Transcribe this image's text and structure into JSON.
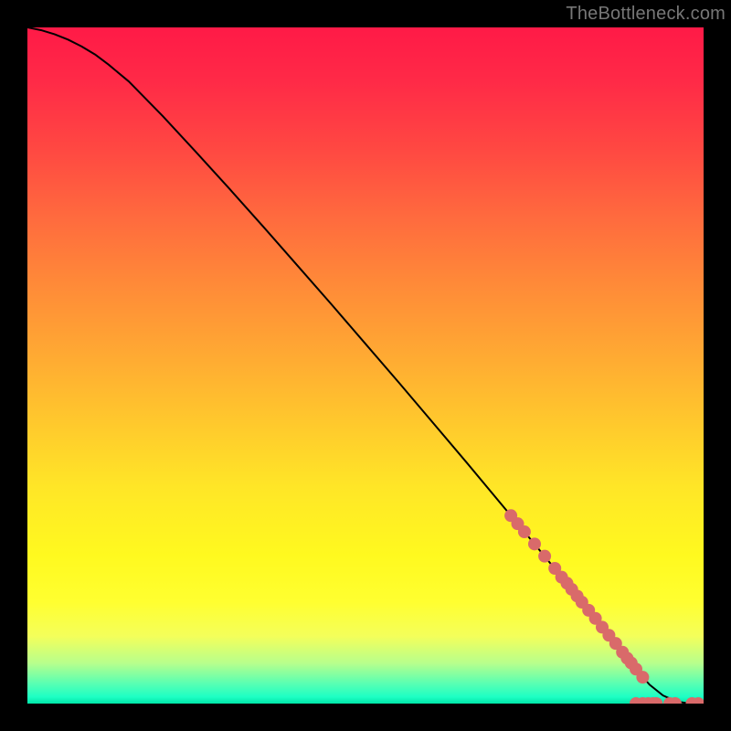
{
  "watermark": "TheBottleneck.com",
  "colors": {
    "curve": "#000000",
    "marker_fill": "#d96a6a",
    "marker_stroke": "#b85454",
    "bg_top": "#ff1a47",
    "bg_bottom": "#00e6a8",
    "page_bg": "#000000"
  },
  "chart_data": {
    "type": "line",
    "title": "",
    "xlabel": "",
    "ylabel": "",
    "xlim": [
      0,
      100
    ],
    "ylim": [
      0,
      100
    ],
    "grid": false,
    "legend": false,
    "series": [
      {
        "name": "curve",
        "x": [
          0,
          2,
          4,
          6,
          8,
          10,
          12,
          15,
          20,
          25,
          30,
          35,
          40,
          45,
          50,
          55,
          60,
          65,
          70,
          75,
          80,
          83,
          85,
          88,
          90,
          92,
          94,
          96,
          98,
          100
        ],
        "y": [
          100,
          99.6,
          99.0,
          98.2,
          97.2,
          96.0,
          94.5,
          92.0,
          86.9,
          81.5,
          76.0,
          70.4,
          64.7,
          59.0,
          53.2,
          47.4,
          41.5,
          35.6,
          29.6,
          23.6,
          17.5,
          13.8,
          11.3,
          7.6,
          5.1,
          2.8,
          1.2,
          0.3,
          0.0,
          0.0
        ]
      }
    ],
    "markers": [
      {
        "x": 71.5,
        "y": 27.8
      },
      {
        "x": 72.5,
        "y": 26.6
      },
      {
        "x": 73.5,
        "y": 25.4
      },
      {
        "x": 75.0,
        "y": 23.6
      },
      {
        "x": 76.5,
        "y": 21.8
      },
      {
        "x": 78.0,
        "y": 20.0
      },
      {
        "x": 79.0,
        "y": 18.7
      },
      {
        "x": 79.8,
        "y": 17.8
      },
      {
        "x": 80.5,
        "y": 16.9
      },
      {
        "x": 81.3,
        "y": 15.9
      },
      {
        "x": 82.0,
        "y": 15.0
      },
      {
        "x": 83.0,
        "y": 13.8
      },
      {
        "x": 84.0,
        "y": 12.6
      },
      {
        "x": 85.0,
        "y": 11.3
      },
      {
        "x": 86.0,
        "y": 10.1
      },
      {
        "x": 87.0,
        "y": 8.9
      },
      {
        "x": 88.0,
        "y": 7.6
      },
      {
        "x": 88.7,
        "y": 6.7
      },
      {
        "x": 89.3,
        "y": 6.0
      },
      {
        "x": 90.0,
        "y": 5.1
      },
      {
        "x": 91.0,
        "y": 3.9
      },
      {
        "x": 90.0,
        "y": 0.0
      },
      {
        "x": 91.0,
        "y": 0.0
      },
      {
        "x": 91.8,
        "y": 0.0
      },
      {
        "x": 92.5,
        "y": 0.0
      },
      {
        "x": 93.0,
        "y": 0.0
      },
      {
        "x": 95.0,
        "y": 0.0
      },
      {
        "x": 95.8,
        "y": 0.0
      },
      {
        "x": 98.3,
        "y": 0.0
      },
      {
        "x": 99.2,
        "y": 0.0
      }
    ]
  }
}
